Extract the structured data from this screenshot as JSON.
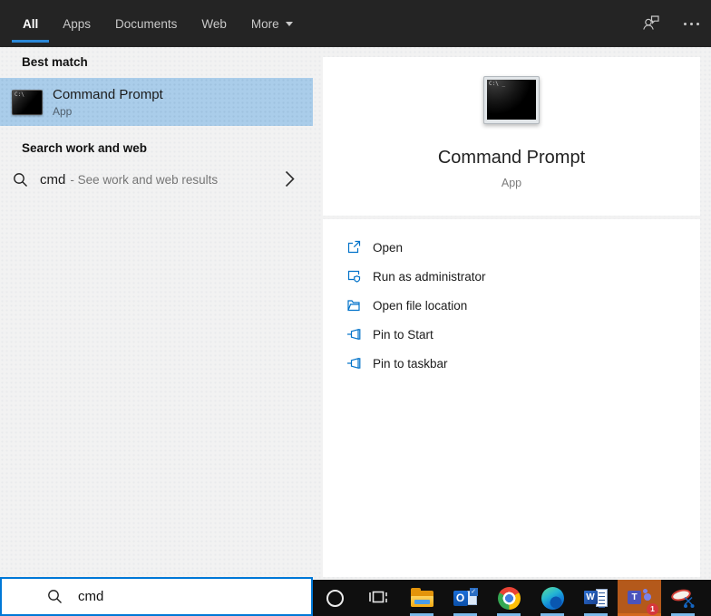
{
  "header": {
    "tabs": [
      {
        "label": "All",
        "active": true
      },
      {
        "label": "Apps",
        "active": false
      },
      {
        "label": "Documents",
        "active": false
      },
      {
        "label": "Web",
        "active": false
      },
      {
        "label": "More",
        "active": false,
        "has_dropdown": true
      }
    ],
    "icons": [
      "feedback-icon",
      "ellipsis-icon"
    ]
  },
  "left_panel": {
    "best_match": {
      "heading": "Best match",
      "item": {
        "title": "Command Prompt",
        "subtitle": "App",
        "icon": "command-prompt-icon"
      }
    },
    "search_web": {
      "heading": "Search work and web",
      "query": "cmd",
      "description": "- See work and web results",
      "icons": [
        "search-icon",
        "chevron-right-icon"
      ]
    },
    "search_box": {
      "value": "cmd",
      "icon": "search-icon"
    }
  },
  "right_panel": {
    "app": {
      "title": "Command Prompt",
      "subtitle": "App",
      "icon": "command-prompt-icon-large"
    },
    "actions": [
      {
        "label": "Open",
        "icon": "open-icon"
      },
      {
        "label": "Run as administrator",
        "icon": "admin-shield-icon"
      },
      {
        "label": "Open file location",
        "icon": "folder-open-icon"
      },
      {
        "label": "Pin to Start",
        "icon": "pin-icon"
      },
      {
        "label": "Pin to taskbar",
        "icon": "pin-icon"
      }
    ]
  },
  "taskbar": {
    "items": [
      {
        "name": "cortana",
        "open": false
      },
      {
        "name": "task-view",
        "open": false
      },
      {
        "name": "file-explorer",
        "open": true
      },
      {
        "name": "outlook",
        "open": true
      },
      {
        "name": "chrome",
        "open": true
      },
      {
        "name": "edge",
        "open": true
      },
      {
        "name": "word",
        "open": true
      },
      {
        "name": "teams",
        "open": true,
        "attention": true,
        "badge": "1"
      },
      {
        "name": "snipping-tool",
        "open": true
      }
    ]
  },
  "colors": {
    "accent": "#0078d7",
    "tab_underline": "#2b88d8",
    "highlight": "#aacdea",
    "header_bg": "#242424",
    "taskbar_bg": "#0f0f0f",
    "attention_tile": "#b4591b",
    "open_indicator": "#7ab8e8",
    "action_icon_blue": "#0072c9"
  }
}
